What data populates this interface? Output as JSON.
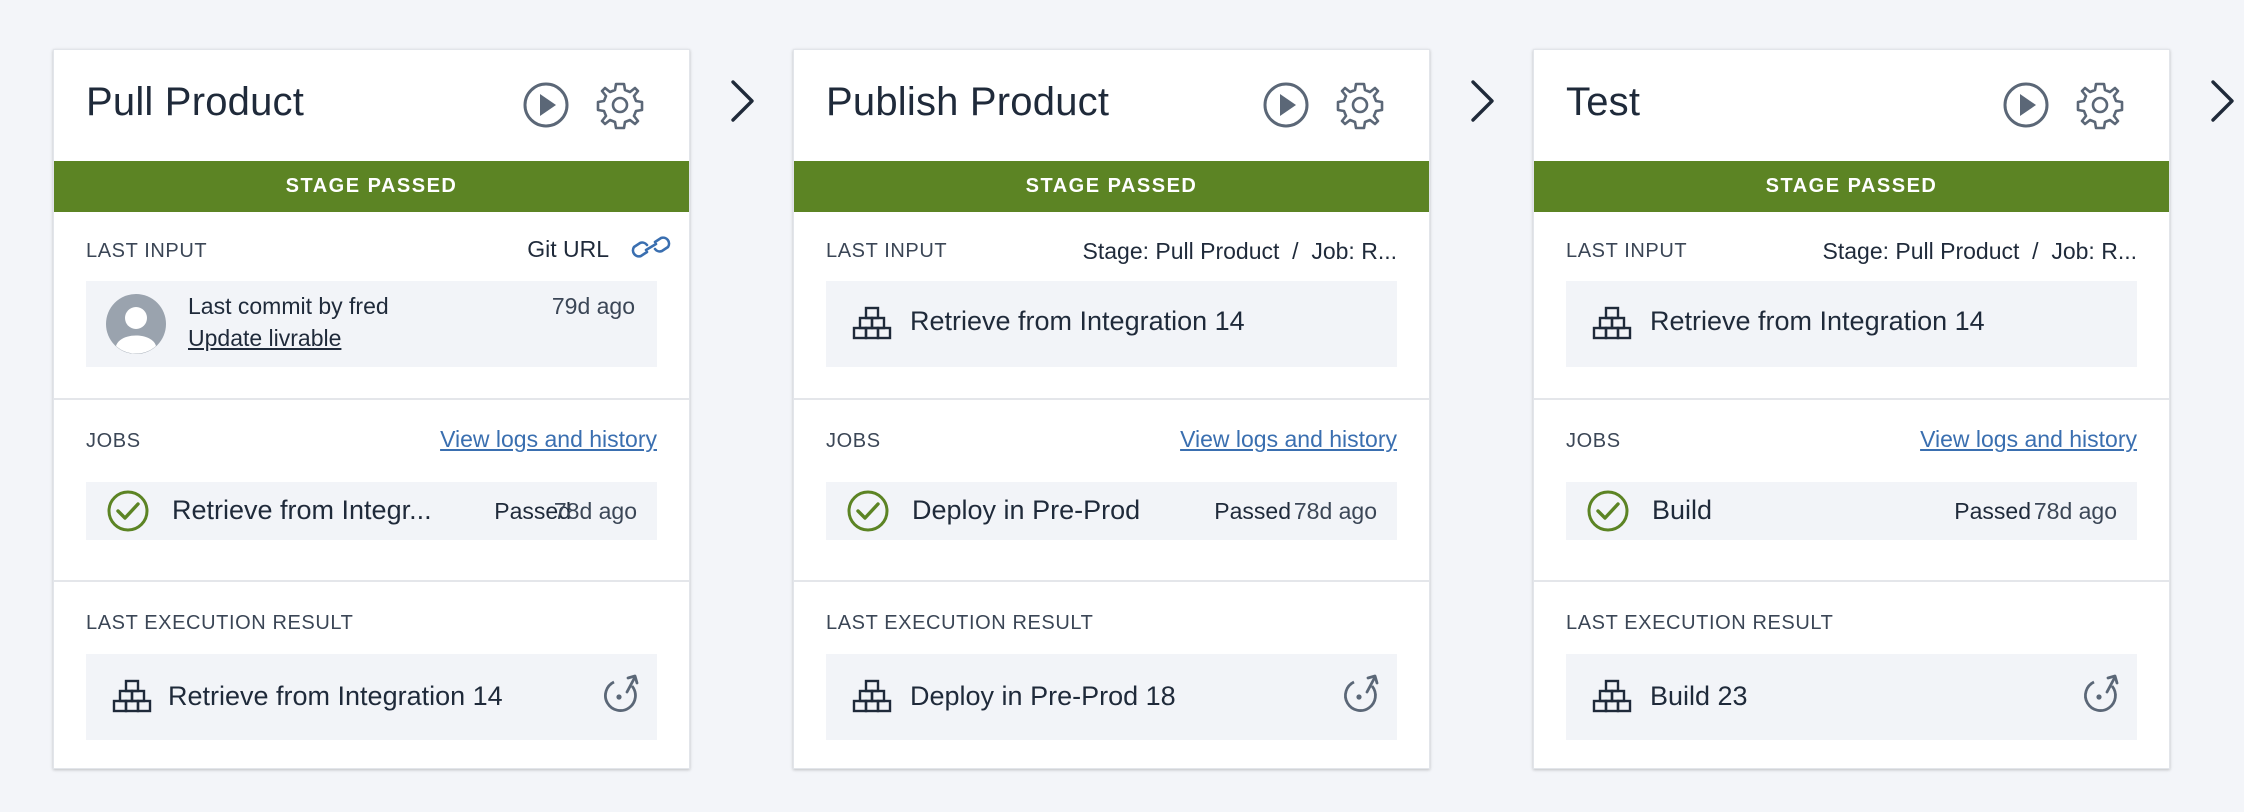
{
  "colors": {
    "stage_passed": "#5c8424",
    "success_check": "#5c8424",
    "link": "#3a6fb0",
    "icon": "#5b6777"
  },
  "labels": {
    "last_input": "LAST INPUT",
    "jobs": "JOBS",
    "last_execution_result": "LAST EXECUTION RESULT",
    "view_logs": "View logs and history"
  },
  "stages": [
    {
      "title": "Pull Product",
      "status": "STAGE PASSED",
      "last_input": {
        "source": "Git URL",
        "icon": "link-icon",
        "commit_by": "Last commit by fred",
        "commit_link": "Update livrable",
        "commit_time": "79d ago"
      },
      "job": {
        "name": "Retrieve from Integr...",
        "status": "Passed",
        "time": "78d ago"
      },
      "last_execution": "Retrieve from Integration 14"
    },
    {
      "title": "Publish Product",
      "status": "STAGE PASSED",
      "last_input": {
        "source": "Stage: Pull Product  /  Job: R...",
        "item": "Retrieve from Integration 14"
      },
      "job": {
        "name": "Deploy in Pre-Prod",
        "status": "Passed",
        "time": "78d ago"
      },
      "last_execution": "Deploy in Pre-Prod 18"
    },
    {
      "title": "Test",
      "status": "STAGE PASSED",
      "last_input": {
        "source": "Stage: Pull Product  /  Job: R...",
        "item": "Retrieve from Integration 14"
      },
      "job": {
        "name": "Build",
        "status": "Passed",
        "time": "78d ago"
      },
      "last_execution": "Build 23"
    }
  ]
}
